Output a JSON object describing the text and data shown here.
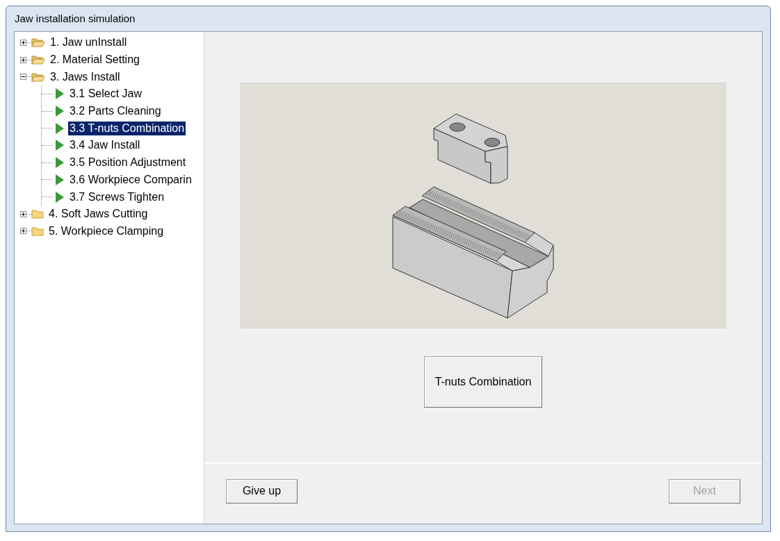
{
  "window": {
    "title": "Jaw installation simulation"
  },
  "tree": [
    {
      "label": "1. Jaw unInstall",
      "folder_open": true,
      "expanded": false,
      "selected": false
    },
    {
      "label": "2. Material Setting",
      "folder_open": true,
      "expanded": false,
      "selected": false
    },
    {
      "label": "3. Jaws Install",
      "folder_open": true,
      "expanded": true,
      "selected": false,
      "children": [
        {
          "label": "3.1 Select Jaw",
          "selected": false
        },
        {
          "label": "3.2 Parts Cleaning",
          "selected": false
        },
        {
          "label": "3.3 T-nuts Combination",
          "selected": true
        },
        {
          "label": "3.4 Jaw Install",
          "selected": false
        },
        {
          "label": "3.5 Position Adjustment",
          "selected": false
        },
        {
          "label": "3.6 Workpiece Comparin",
          "selected": false
        },
        {
          "label": "3.7 Screws Tighten",
          "selected": false
        }
      ]
    },
    {
      "label": "4. Soft Jaws Cutting",
      "folder_open": false,
      "expanded": false,
      "selected": false
    },
    {
      "label": "5. Workpiece Clamping",
      "folder_open": false,
      "expanded": false,
      "selected": false
    }
  ],
  "step_button": {
    "label": "T-nuts Combination"
  },
  "footer": {
    "buttons": [
      {
        "label": "Give up",
        "disabled": false
      },
      {
        "label": "Next",
        "disabled": true
      }
    ]
  }
}
